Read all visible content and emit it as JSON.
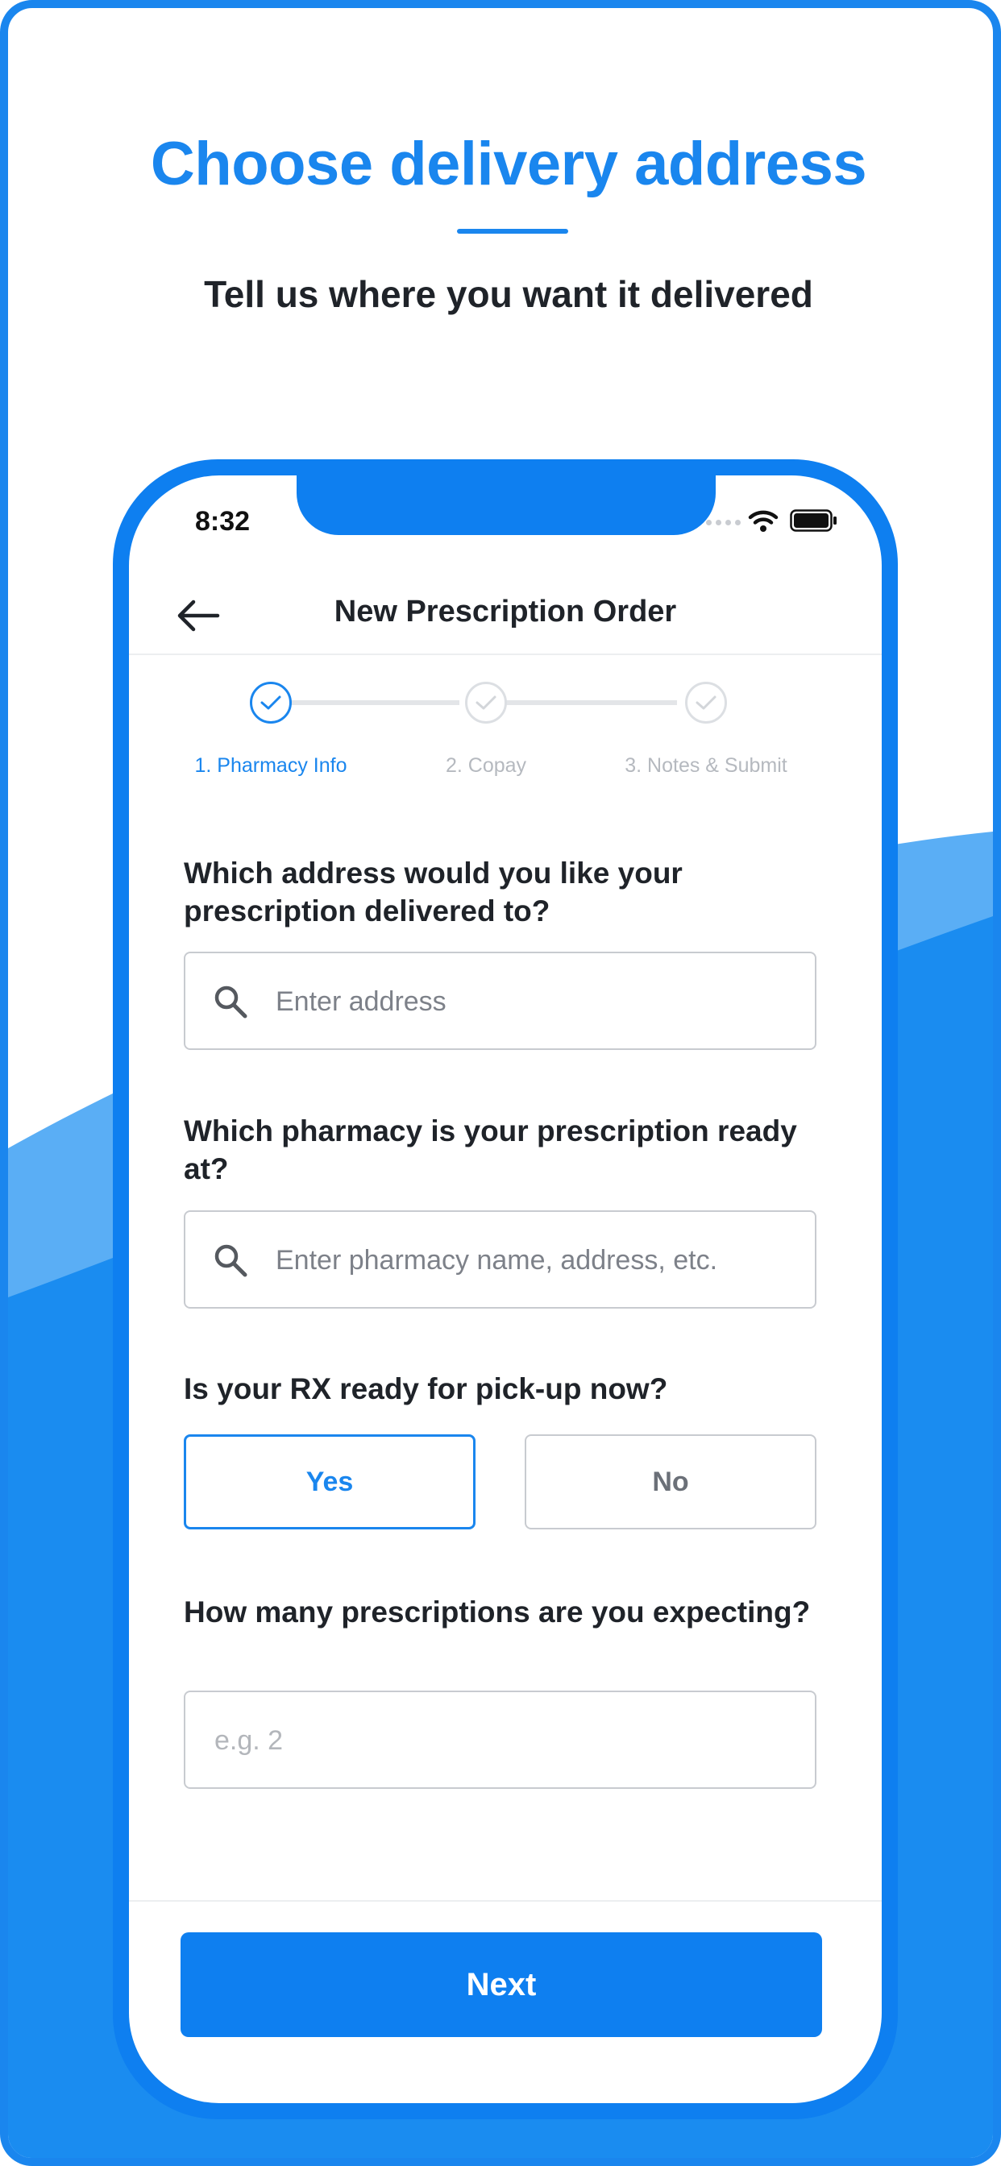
{
  "marketing": {
    "headline": "Choose delivery address",
    "subheadline": "Tell us where you want it delivered"
  },
  "status_bar": {
    "time": "8:32"
  },
  "nav": {
    "title": "New Prescription Order",
    "back_icon": "arrow-left-icon"
  },
  "stepper": {
    "steps": [
      {
        "label": "1. Pharmacy Info",
        "state": "active"
      },
      {
        "label": "2. Copay",
        "state": "inactive"
      },
      {
        "label": "3. Notes & Submit",
        "state": "inactive"
      }
    ]
  },
  "form": {
    "address": {
      "question": "Which address would you like your prescription delivered to?",
      "placeholder": "Enter address",
      "value": ""
    },
    "pharmacy": {
      "question": "Which pharmacy is your prescription ready at?",
      "placeholder": "Enter pharmacy name, address, etc.",
      "value": ""
    },
    "pickup_ready": {
      "question": "Is your RX ready for pick-up now?",
      "options": [
        "Yes",
        "No"
      ],
      "selected": "Yes"
    },
    "count": {
      "question": "How many prescriptions are you expecting?",
      "placeholder": "e.g. 2",
      "value": ""
    }
  },
  "footer": {
    "next_label": "Next"
  },
  "colors": {
    "brand_blue": "#1a86ee",
    "light_blue": "#5aaef5",
    "text_dark": "#1f2329"
  }
}
